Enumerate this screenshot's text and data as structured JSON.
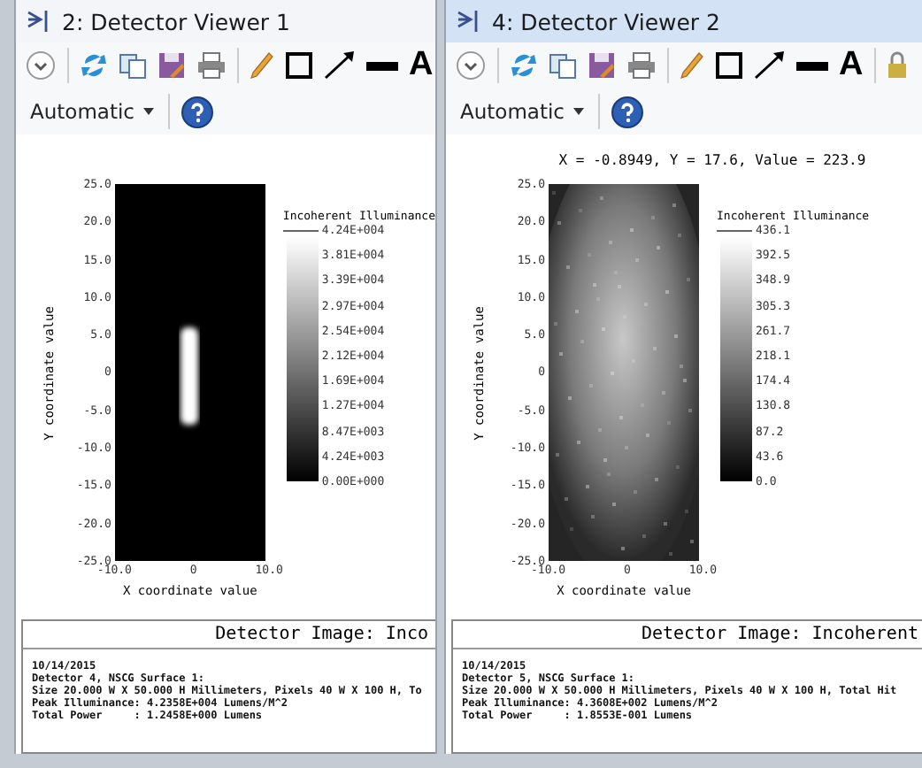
{
  "windows": [
    {
      "title": "2: Detector Viewer 1",
      "active": false,
      "toolbar": [
        {
          "kind": "expand"
        },
        {
          "kind": "refresh"
        },
        {
          "kind": "copy"
        },
        {
          "kind": "save"
        },
        {
          "kind": "print"
        },
        {
          "kind": "pencil"
        },
        {
          "kind": "rectangle"
        },
        {
          "kind": "arrow"
        },
        {
          "kind": "line"
        },
        {
          "kind": "text",
          "label": "A"
        }
      ],
      "mode": "Automatic",
      "plot": {
        "kind": "spot",
        "y_label": "Y coordinate value",
        "x_label": "X coordinate value",
        "y_ticks": [
          "25.0",
          "20.0",
          "15.0",
          "10.0",
          "5.0",
          "0",
          "-5.0",
          "-10.0",
          "-15.0",
          "-20.0",
          "-25.0"
        ],
        "x_ticks": [
          "-10.0",
          "0",
          "10.0"
        ],
        "colorbar_title": "Incoherent Illuminance",
        "colorbar_ticks": [
          "4.24E+004",
          "3.81E+004",
          "3.39E+004",
          "2.97E+004",
          "2.54E+004",
          "2.12E+004",
          "1.69E+004",
          "1.27E+004",
          "8.47E+003",
          "4.24E+003",
          "0.00E+000"
        ]
      },
      "report": {
        "header": "Detector Image: Inco",
        "lines": [
          "10/14/2015",
          "Detector 4, NSCG Surface 1:",
          "Size 20.000 W X 50.000 H Millimeters, Pixels 40 W X 100 H, To",
          "Peak Illuminance: 4.2358E+004 Lumens/M^2",
          "Total Power     : 1.2458E+000 Lumens"
        ]
      }
    },
    {
      "title": "4: Detector Viewer 2",
      "active": true,
      "toolbar": [
        {
          "kind": "expand"
        },
        {
          "kind": "refresh"
        },
        {
          "kind": "copy"
        },
        {
          "kind": "save"
        },
        {
          "kind": "print"
        },
        {
          "kind": "pencil"
        },
        {
          "kind": "rectangle"
        },
        {
          "kind": "arrow"
        },
        {
          "kind": "line"
        },
        {
          "kind": "text",
          "label": "A"
        },
        {
          "kind": "lock"
        }
      ],
      "mode": "Automatic",
      "readout": "X = -0.8949, Y = 17.6, Value = 223.9",
      "plot": {
        "kind": "diffuse",
        "y_label": "Y coordinate value",
        "x_label": "X coordinate value",
        "y_ticks": [
          "25.0",
          "20.0",
          "15.0",
          "10.0",
          "5.0",
          "0",
          "-5.0",
          "-10.0",
          "-15.0",
          "-20.0",
          "-25.0"
        ],
        "x_ticks": [
          "-10.0",
          "0",
          "10.0"
        ],
        "colorbar_title": "Incoherent Illuminance",
        "colorbar_ticks": [
          "436.1",
          "392.5",
          "348.9",
          "305.3",
          "261.7",
          "218.1",
          "174.4",
          "130.8",
          "87.2",
          "43.6",
          "0.0"
        ]
      },
      "report": {
        "header": "Detector Image: Incoherent",
        "lines": [
          "10/14/2015",
          "Detector 5, NSCG Surface 1:",
          "Size 20.000 W X 50.000 H Millimeters, Pixels 40 W X 100 H, Total Hit",
          "Peak Illuminance: 4.3608E+002 Lumens/M^2",
          "Total Power     : 1.8553E-001 Lumens"
        ]
      }
    }
  ]
}
